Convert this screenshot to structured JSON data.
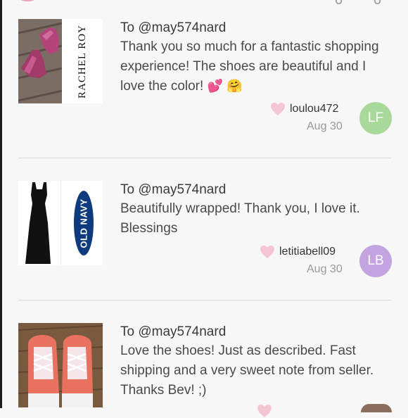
{
  "reviews": [
    {
      "brand": "RACHEL ROY",
      "to": "To @may574nard",
      "message": "Thank you so much for a fantastic shopping experience! The shoes are beautiful and I love the color!",
      "emojis": "💕 🤗",
      "user": "loulou472",
      "date": "Aug 30",
      "avatar": {
        "initials": "LF",
        "color": "#a9d99a"
      }
    },
    {
      "brand": "OLD NAVY",
      "to": "To @may574nard",
      "message": "Beautifully wrapped! Thank you, I love it. Blessings",
      "user": "letitiabell09",
      "date": "Aug 30",
      "avatar": {
        "initials": "LB",
        "color": "#c3a3e0"
      }
    },
    {
      "to": "To @may574nard",
      "message": "Love the shoes! Just as described. Fast shipping and a very sweet note from seller. Thanks Bev! ;)"
    }
  ],
  "colors": {
    "heart": "#f4c6d3",
    "divider": "#d9d6d8"
  }
}
